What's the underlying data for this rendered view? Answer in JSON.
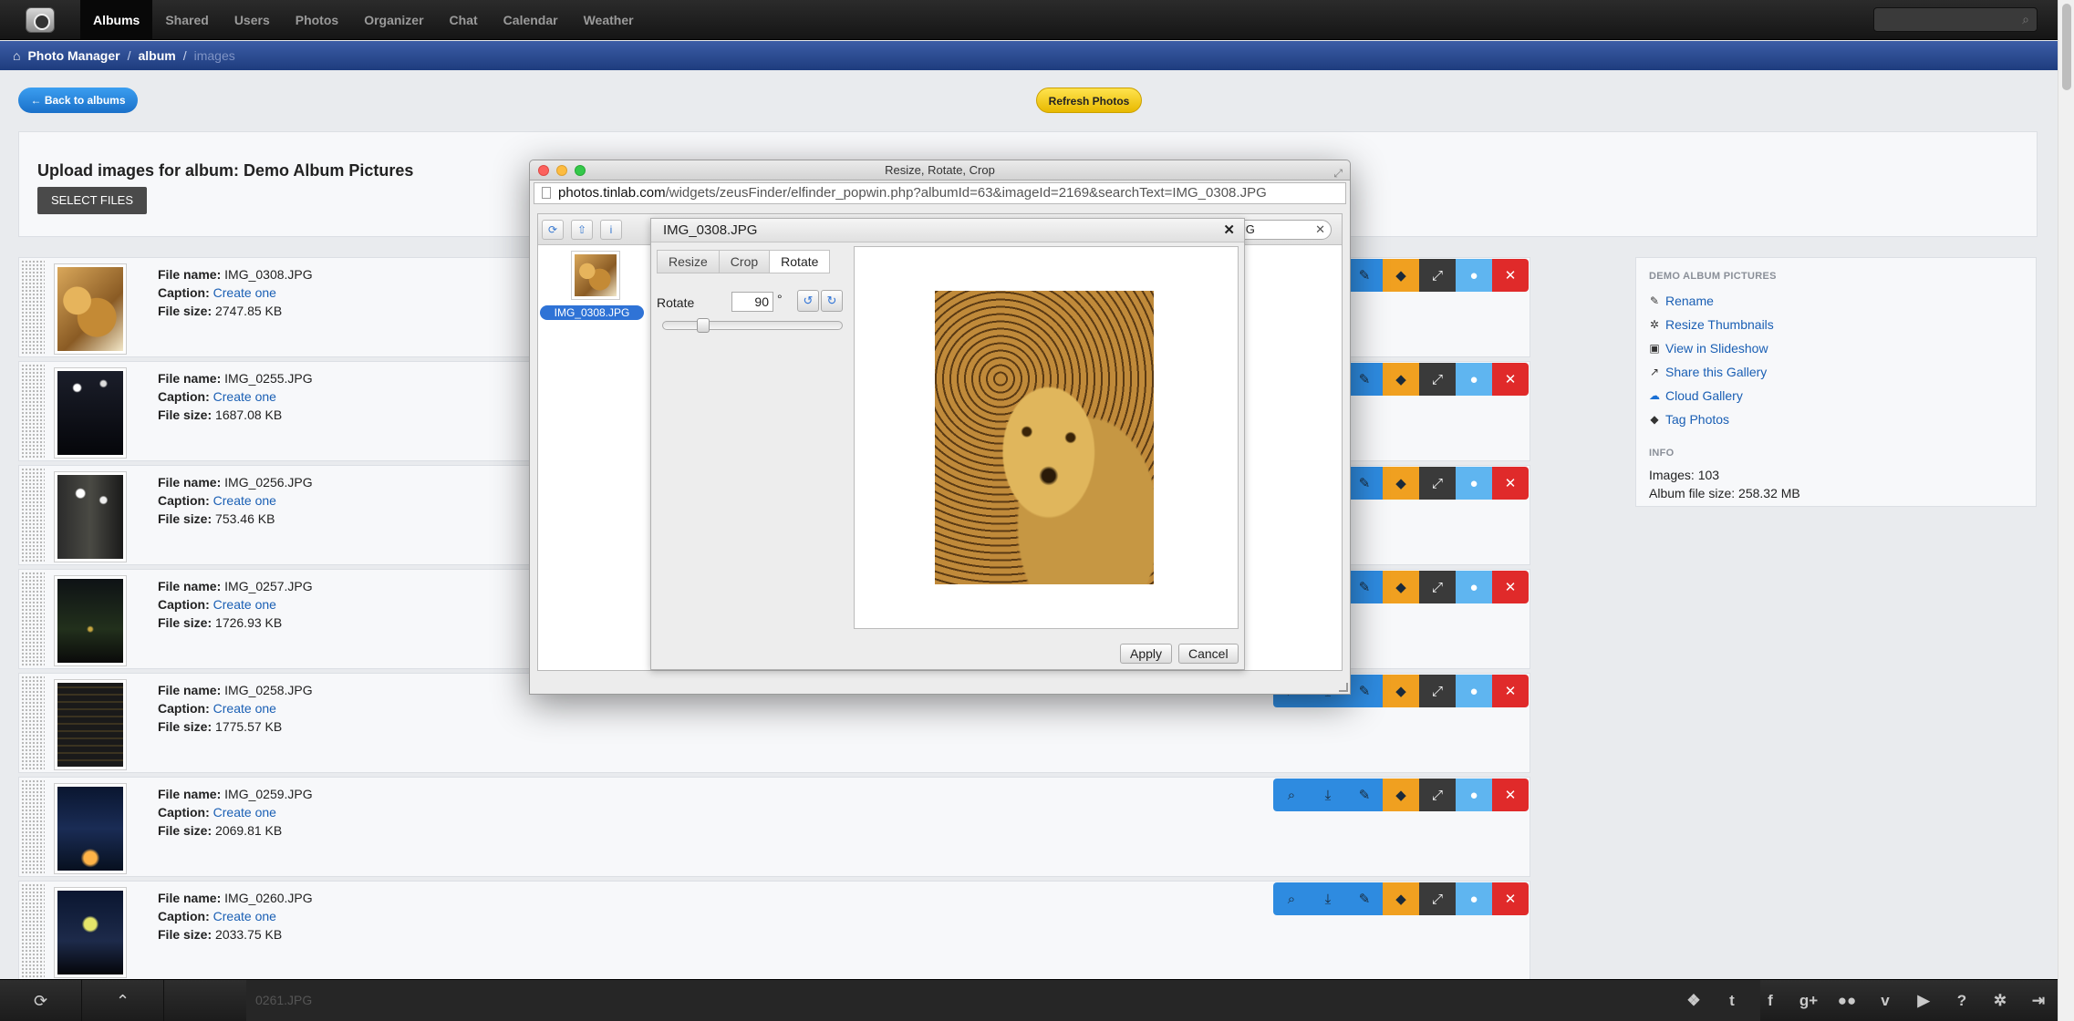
{
  "nav": {
    "items": [
      "Albums",
      "Shared",
      "Users",
      "Photos",
      "Organizer",
      "Chat",
      "Calendar",
      "Weather"
    ],
    "active": "Albums"
  },
  "breadcrumb": {
    "home": "Photo Manager",
    "album": "album",
    "current": "images",
    "sep": "/"
  },
  "actions": {
    "back": "← Back to albums",
    "refresh": "Refresh Photos"
  },
  "upload": {
    "title": "Upload images for album: Demo Album Pictures",
    "select_files": "SELECT FILES"
  },
  "labels": {
    "file_name": "File name:",
    "caption": "Caption:",
    "file_size": "File size:",
    "create_one": "Create one"
  },
  "images": [
    {
      "file": "IMG_0308.JPG",
      "size": "2747.85 KB"
    },
    {
      "file": "IMG_0255.JPG",
      "size": "1687.08 KB"
    },
    {
      "file": "IMG_0256.JPG",
      "size": "753.46 KB"
    },
    {
      "file": "IMG_0257.JPG",
      "size": "1726.93 KB"
    },
    {
      "file": "IMG_0258.JPG",
      "size": "1775.57 KB"
    },
    {
      "file": "IMG_0259.JPG",
      "size": "2069.81 KB"
    },
    {
      "file": "IMG_0260.JPG",
      "size": "2033.75 KB"
    }
  ],
  "sidebar": {
    "heading": "DEMO ALBUM PICTURES",
    "links": [
      "Rename",
      "Resize Thumbnails",
      "View in Slideshow",
      "Share this Gallery",
      "Cloud Gallery",
      "Tag Photos"
    ],
    "info_heading": "INFO",
    "images_count": "Images: 103",
    "album_size": "Album file size: 258.32 MB"
  },
  "modal": {
    "window_title": "Resize, Rotate, Crop",
    "url_host": "photos.tinlab.com",
    "url_path": "/widgets/zeusFinder/elfinder_popwin.php?albumId=63&imageId=2169&searchText=IMG_0308.JPG",
    "search_value": ".JPG",
    "selected_file": "IMG_0308.JPG",
    "dialog_title": "IMG_0308.JPG",
    "tabs": [
      "Resize",
      "Crop",
      "Rotate"
    ],
    "active_tab": "Rotate",
    "rotate_label": "Rotate",
    "rotate_value": "90",
    "rotate_unit": "°",
    "rotate_slider_percent": 20,
    "apply": "Apply",
    "cancel": "Cancel"
  },
  "bottom": {
    "partial_file": "0261.JPG"
  },
  "icons": {
    "toolbar": [
      "zoom-icon",
      "download-icon",
      "edit-icon",
      "tag-icon",
      "fullscreen-icon",
      "info-icon",
      "delete-icon"
    ],
    "social": [
      "dropbox-icon",
      "twitter-icon",
      "facebook-icon",
      "google-plus-icon",
      "flickr-icon",
      "vimeo-icon",
      "youtube-icon",
      "help-icon",
      "settings-icon",
      "logout-icon"
    ]
  }
}
